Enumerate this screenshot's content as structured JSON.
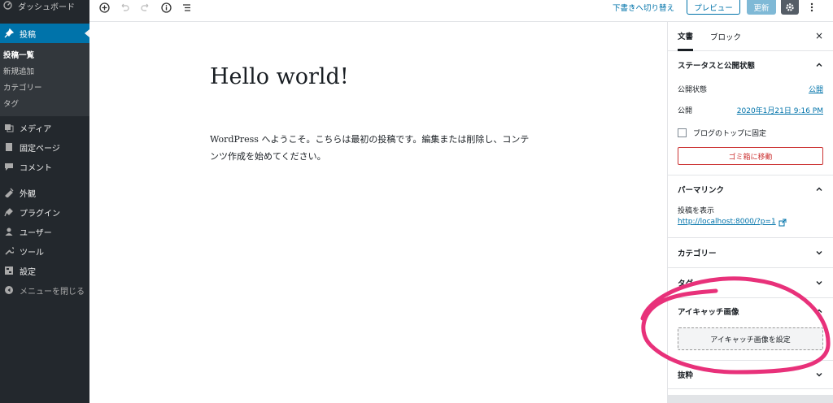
{
  "sidebar": {
    "dashboard": "ダッシュボード",
    "posts": "投稿",
    "submenu": [
      "投稿一覧",
      "新規追加",
      "カテゴリー",
      "タグ"
    ],
    "items": [
      {
        "label": "メディア",
        "icon": "media-icon"
      },
      {
        "label": "固定ページ",
        "icon": "page-icon"
      },
      {
        "label": "コメント",
        "icon": "comment-icon"
      },
      {
        "label": "外観",
        "icon": "appearance-icon"
      },
      {
        "label": "プラグイン",
        "icon": "plugin-icon"
      },
      {
        "label": "ユーザー",
        "icon": "user-icon"
      },
      {
        "label": "ツール",
        "icon": "tool-icon"
      },
      {
        "label": "設定",
        "icon": "settings-icon"
      },
      {
        "label": "メニューを閉じる",
        "icon": "collapse-icon"
      }
    ]
  },
  "toolbar": {
    "draft_switch": "下書きへ切り替え",
    "preview": "プレビュー",
    "update": "更新"
  },
  "editor": {
    "title": "Hello world!",
    "body_line1": "WordPress へようこそ。こちらは最初の投稿です。編集または削除し、コンテ",
    "body_line2": "ンツ作成を始めてください。"
  },
  "panel": {
    "tab_document": "文書",
    "tab_block": "ブロック",
    "close": "×",
    "status": {
      "heading": "ステータスと公開状態",
      "visibility_label": "公開状態",
      "visibility_value": "公開",
      "publish_label": "公開",
      "publish_value": "2020年1月21日 9:16 PM",
      "sticky_label": "ブログのトップに固定",
      "trash": "ゴミ箱に移動"
    },
    "permalink": {
      "heading": "パーマリンク",
      "view_label": "投稿を表示",
      "url": "http://localhost:8000/?p=1"
    },
    "categories": "カテゴリー",
    "tags": "タグ",
    "featured": {
      "heading": "アイキャッチ画像",
      "button": "アイキャッチ画像を設定"
    },
    "excerpt": "抜粋"
  },
  "colors": {
    "sidebar_bg": "#23282d",
    "accent": "#0073aa",
    "annotation": "#e8317a"
  }
}
